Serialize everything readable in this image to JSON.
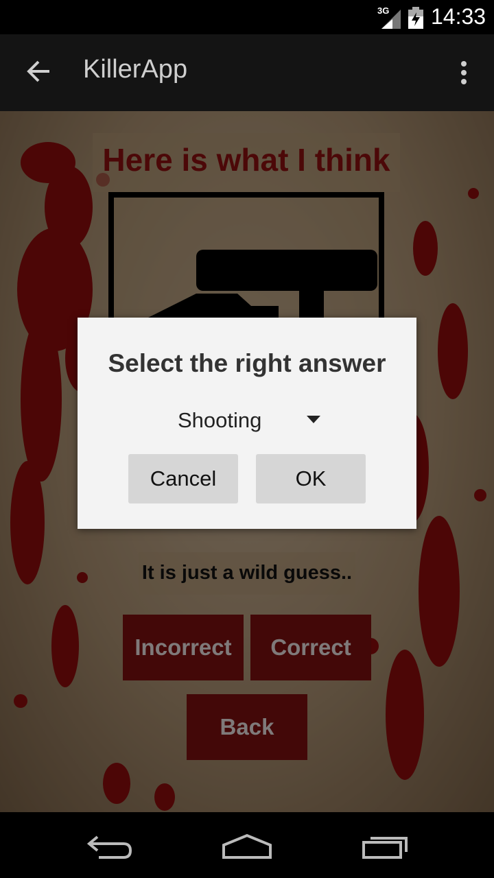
{
  "status_bar": {
    "network": "3G",
    "time": "14:33",
    "signal_icon": "signal-icon",
    "battery_icon": "battery-icon"
  },
  "action_bar": {
    "title": "KillerApp",
    "back_icon": "back-arrow-icon",
    "menu_icon": "overflow-menu-icon"
  },
  "content": {
    "heading": "Here is what I think",
    "guess_text": "It is just a wild guess..",
    "incorrect_label": "Incorrect",
    "correct_label": "Correct",
    "back_label": "Back"
  },
  "dialog": {
    "title": "Select the right answer",
    "selected_option": "Shooting",
    "cancel_label": "Cancel",
    "ok_label": "OK"
  },
  "colors": {
    "accent_red": "#7a1010",
    "heading_red": "#8a1010",
    "dialog_bg": "#f3f3f3"
  }
}
